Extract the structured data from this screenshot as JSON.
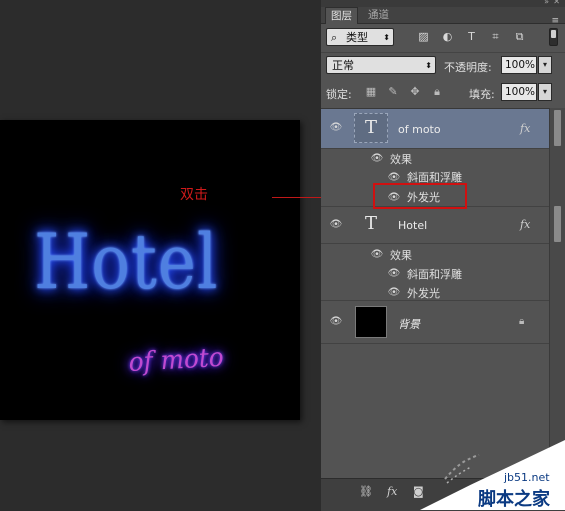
{
  "canvas": {
    "main_text": "Hotel",
    "sub_text": "of moto"
  },
  "annotation": {
    "text": "双击"
  },
  "panel": {
    "tabs": [
      {
        "label": "图层"
      },
      {
        "label": "通道"
      }
    ],
    "filter": {
      "kind_label": "类型"
    },
    "blend_mode": "正常",
    "opacity_label": "不透明度:",
    "opacity_value": "100%",
    "lock_label": "锁定:",
    "fill_label": "填充:",
    "fill_value": "100%"
  },
  "layers": [
    {
      "name": "of moto",
      "type": "text",
      "thumb_glyph": "T",
      "selected": true,
      "has_fx": true,
      "effects_label": "效果",
      "effects": [
        "斜面和浮雕",
        "外发光"
      ]
    },
    {
      "name": "Hotel",
      "type": "text",
      "thumb_glyph": "T",
      "selected": false,
      "has_fx": true,
      "effects_label": "效果",
      "effects": [
        "斜面和浮雕",
        "外发光"
      ]
    },
    {
      "name": "背景",
      "type": "background",
      "locked": true
    }
  ],
  "fx_label": "fx",
  "watermark": {
    "url": "jb51.net",
    "name": "脚本之家"
  },
  "colors": {
    "selected_layer": "#6a7891",
    "annotation_red": "#d01a1a",
    "hotel_glow": "#2b54ff",
    "ofmoto_text": "#c04ad0"
  }
}
